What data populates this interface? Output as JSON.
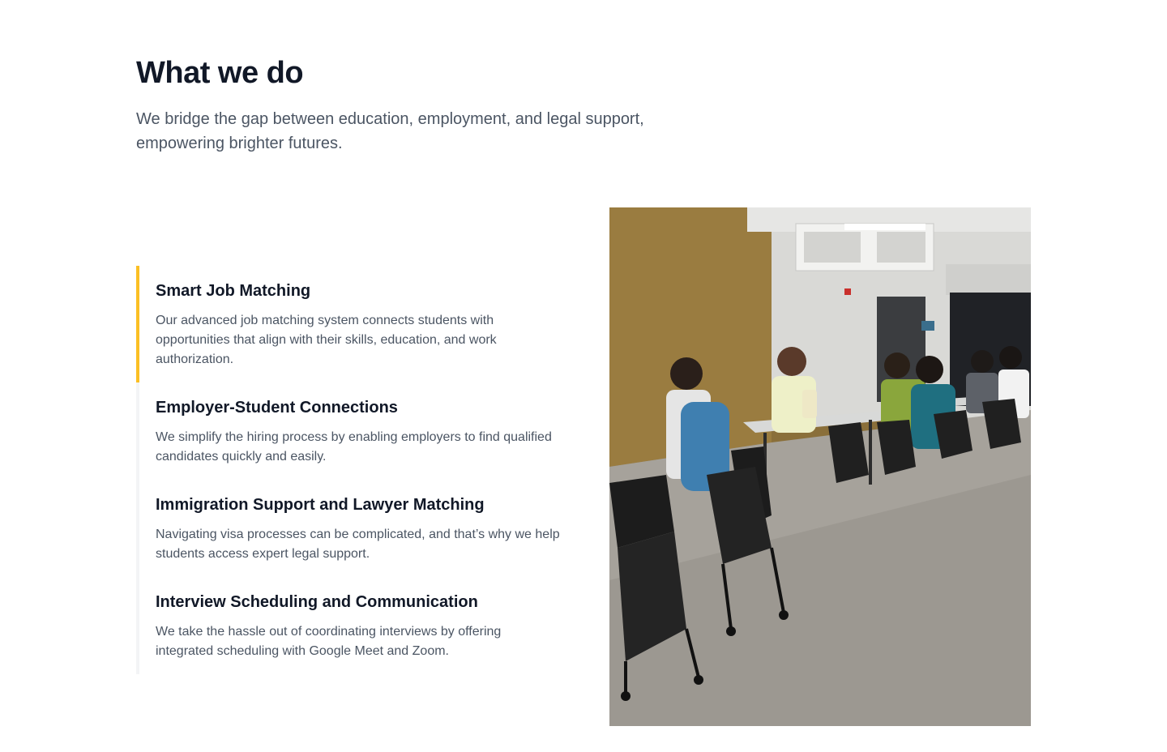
{
  "section": {
    "title": "What we do",
    "subtitle": "We bridge the gap between education, employment, and legal support, empowering brighter futures."
  },
  "features": [
    {
      "title": "Smart Job Matching",
      "description": "Our advanced job matching system connects students with opportunities that align with their skills, education, and work authorization.",
      "active": true
    },
    {
      "title": "Employer-Student Connections",
      "description": "We simplify the hiring process by enabling employers to find qualified candidates quickly and easily.",
      "active": false
    },
    {
      "title": "Immigration Support and Lawyer Matching",
      "description": "Navigating visa processes can be complicated, and that’s why we help students access expert legal support.",
      "active": false
    },
    {
      "title": "Interview Scheduling and Communication",
      "description": "We take the hassle out of coordinating interviews by offering integrated scheduling with Google Meet and Zoom.",
      "active": false
    }
  ],
  "colors": {
    "accent": "#fbbf24",
    "heading": "#111827",
    "body_text": "#4b5563",
    "divider": "#f3f4f6"
  }
}
